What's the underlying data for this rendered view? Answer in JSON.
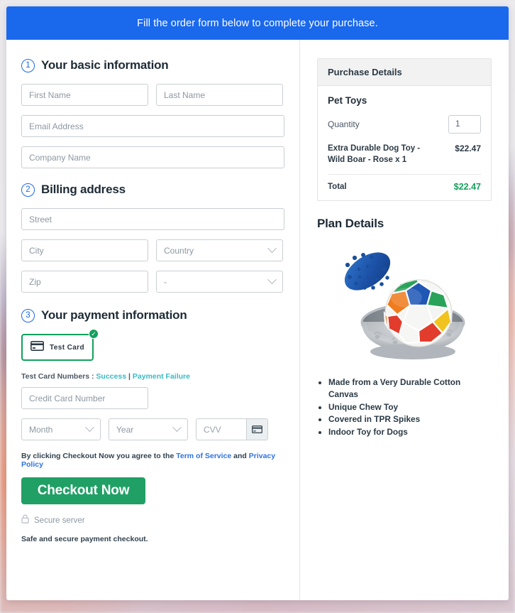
{
  "banner": {
    "text": "Fill the order form below to complete your purchase."
  },
  "sections": {
    "basic": {
      "number": "1",
      "title": "Your basic information",
      "fields": {
        "first_name": "First Name",
        "last_name": "Last Name",
        "email": "Email Address",
        "company": "Company Name"
      }
    },
    "billing": {
      "number": "2",
      "title": "Billing address",
      "fields": {
        "street": "Street",
        "city": "City",
        "country": "Country",
        "zip": "Zip",
        "state": "-"
      }
    },
    "payment": {
      "number": "3",
      "title": "Your payment information",
      "method": {
        "label": "Test  Card",
        "icon": "credit-card-icon",
        "selected_badge": "✓"
      },
      "test_numbers": {
        "prefix": "Test Card Numbers :",
        "success_link": "Success",
        "separator": "|",
        "failure_link": "Payment Failure"
      },
      "fields": {
        "card_number": "Credit Card Number",
        "month": "Month",
        "year": "Year",
        "cvv": "CVV"
      }
    }
  },
  "footer": {
    "terms_prefix": "By clicking Checkout Now you agree to the",
    "terms_link": "Term of Service",
    "terms_and": "and",
    "privacy_link": "Privacy Policy",
    "checkout_label": "Checkout Now",
    "secure_server": "Secure server",
    "safe_note": "Safe and secure payment checkout."
  },
  "purchase": {
    "panel_title": "Purchase Details",
    "product_group": "Pet Toys",
    "quantity_label": "Quantity",
    "quantity_value": "1",
    "line_item_desc": "Extra Durable Dog Toy - Wild Boar - Rose x 1",
    "line_item_amount": "$22.47",
    "total_label": "Total",
    "total_amount": "$22.47"
  },
  "plan": {
    "title": "Plan Details",
    "image_alt": "dog-toy-ball-in-bowl-image",
    "features": [
      "Made from a Very Durable Cotton Canvas",
      "Unique Chew Toy",
      "Covered in TPR Spikes",
      "Indoor Toy for Dogs"
    ]
  },
  "colors": {
    "banner_blue": "#1a68ec",
    "accent_blue": "#2f72e0",
    "success_green": "#20a065",
    "total_green": "#16a05d",
    "link_teal": "#3bb9c4",
    "selected_border": "#12a05c"
  }
}
